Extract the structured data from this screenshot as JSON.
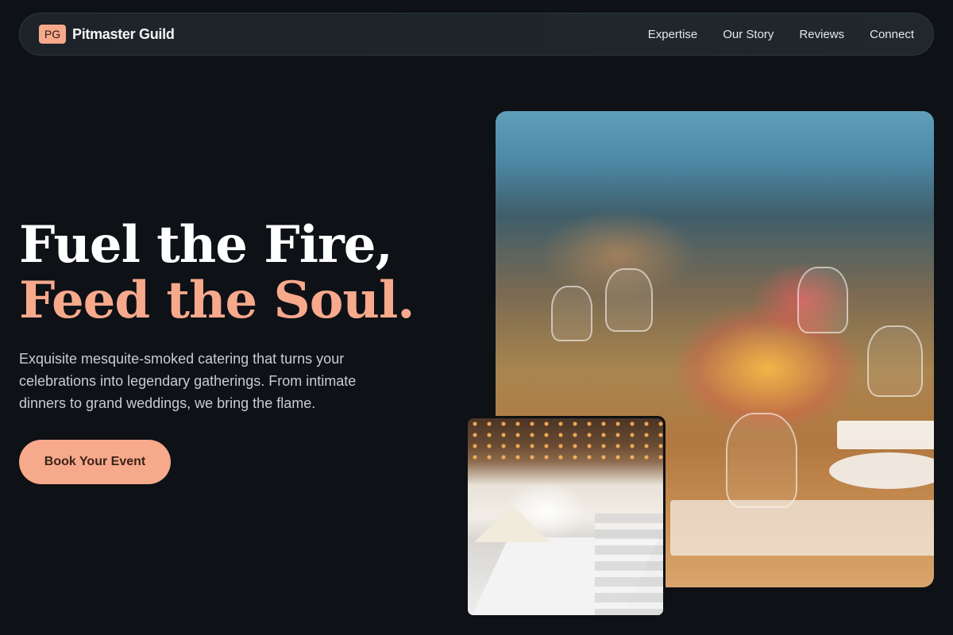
{
  "brand": {
    "badge": "PG",
    "name": "Pitmaster Guild"
  },
  "nav": {
    "links": [
      "Expertise",
      "Our Story",
      "Reviews",
      "Connect"
    ]
  },
  "hero": {
    "title_line1": "Fuel the Fire,",
    "title_line2": "Feed the Soul.",
    "description": "Exquisite mesquite-smoked catering that turns your celebrations into legendary gatherings. From intimate dinners to grand weddings, we bring the flame.",
    "cta_label": "Book Your Event"
  },
  "colors": {
    "background": "#0e1116",
    "accent": "#f7a98c",
    "nav_bg": "#1f252b"
  }
}
